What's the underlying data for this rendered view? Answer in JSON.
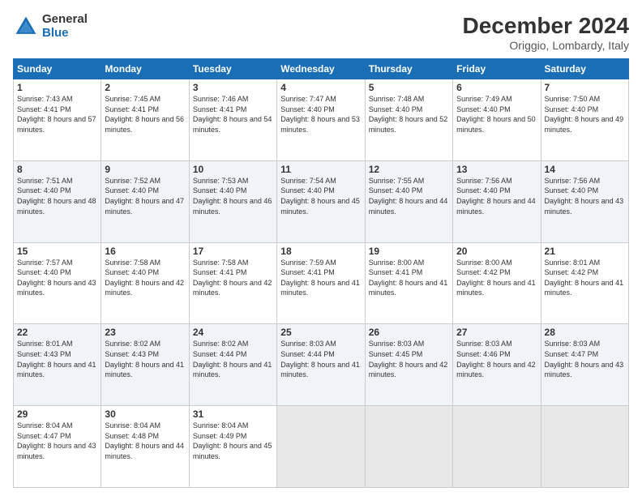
{
  "logo": {
    "general": "General",
    "blue": "Blue"
  },
  "title": {
    "month": "December 2024",
    "location": "Origgio, Lombardy, Italy"
  },
  "header": {
    "days": [
      "Sunday",
      "Monday",
      "Tuesday",
      "Wednesday",
      "Thursday",
      "Friday",
      "Saturday"
    ]
  },
  "weeks": [
    [
      {
        "day": "1",
        "sunrise": "7:43 AM",
        "sunset": "4:41 PM",
        "daylight": "8 hours and 57 minutes."
      },
      {
        "day": "2",
        "sunrise": "7:45 AM",
        "sunset": "4:41 PM",
        "daylight": "8 hours and 56 minutes."
      },
      {
        "day": "3",
        "sunrise": "7:46 AM",
        "sunset": "4:41 PM",
        "daylight": "8 hours and 54 minutes."
      },
      {
        "day": "4",
        "sunrise": "7:47 AM",
        "sunset": "4:40 PM",
        "daylight": "8 hours and 53 minutes."
      },
      {
        "day": "5",
        "sunrise": "7:48 AM",
        "sunset": "4:40 PM",
        "daylight": "8 hours and 52 minutes."
      },
      {
        "day": "6",
        "sunrise": "7:49 AM",
        "sunset": "4:40 PM",
        "daylight": "8 hours and 50 minutes."
      },
      {
        "day": "7",
        "sunrise": "7:50 AM",
        "sunset": "4:40 PM",
        "daylight": "8 hours and 49 minutes."
      }
    ],
    [
      {
        "day": "8",
        "sunrise": "7:51 AM",
        "sunset": "4:40 PM",
        "daylight": "8 hours and 48 minutes."
      },
      {
        "day": "9",
        "sunrise": "7:52 AM",
        "sunset": "4:40 PM",
        "daylight": "8 hours and 47 minutes."
      },
      {
        "day": "10",
        "sunrise": "7:53 AM",
        "sunset": "4:40 PM",
        "daylight": "8 hours and 46 minutes."
      },
      {
        "day": "11",
        "sunrise": "7:54 AM",
        "sunset": "4:40 PM",
        "daylight": "8 hours and 45 minutes."
      },
      {
        "day": "12",
        "sunrise": "7:55 AM",
        "sunset": "4:40 PM",
        "daylight": "8 hours and 44 minutes."
      },
      {
        "day": "13",
        "sunrise": "7:56 AM",
        "sunset": "4:40 PM",
        "daylight": "8 hours and 44 minutes."
      },
      {
        "day": "14",
        "sunrise": "7:56 AM",
        "sunset": "4:40 PM",
        "daylight": "8 hours and 43 minutes."
      }
    ],
    [
      {
        "day": "15",
        "sunrise": "7:57 AM",
        "sunset": "4:40 PM",
        "daylight": "8 hours and 43 minutes."
      },
      {
        "day": "16",
        "sunrise": "7:58 AM",
        "sunset": "4:40 PM",
        "daylight": "8 hours and 42 minutes."
      },
      {
        "day": "17",
        "sunrise": "7:58 AM",
        "sunset": "4:41 PM",
        "daylight": "8 hours and 42 minutes."
      },
      {
        "day": "18",
        "sunrise": "7:59 AM",
        "sunset": "4:41 PM",
        "daylight": "8 hours and 41 minutes."
      },
      {
        "day": "19",
        "sunrise": "8:00 AM",
        "sunset": "4:41 PM",
        "daylight": "8 hours and 41 minutes."
      },
      {
        "day": "20",
        "sunrise": "8:00 AM",
        "sunset": "4:42 PM",
        "daylight": "8 hours and 41 minutes."
      },
      {
        "day": "21",
        "sunrise": "8:01 AM",
        "sunset": "4:42 PM",
        "daylight": "8 hours and 41 minutes."
      }
    ],
    [
      {
        "day": "22",
        "sunrise": "8:01 AM",
        "sunset": "4:43 PM",
        "daylight": "8 hours and 41 minutes."
      },
      {
        "day": "23",
        "sunrise": "8:02 AM",
        "sunset": "4:43 PM",
        "daylight": "8 hours and 41 minutes."
      },
      {
        "day": "24",
        "sunrise": "8:02 AM",
        "sunset": "4:44 PM",
        "daylight": "8 hours and 41 minutes."
      },
      {
        "day": "25",
        "sunrise": "8:03 AM",
        "sunset": "4:44 PM",
        "daylight": "8 hours and 41 minutes."
      },
      {
        "day": "26",
        "sunrise": "8:03 AM",
        "sunset": "4:45 PM",
        "daylight": "8 hours and 42 minutes."
      },
      {
        "day": "27",
        "sunrise": "8:03 AM",
        "sunset": "4:46 PM",
        "daylight": "8 hours and 42 minutes."
      },
      {
        "day": "28",
        "sunrise": "8:03 AM",
        "sunset": "4:47 PM",
        "daylight": "8 hours and 43 minutes."
      }
    ],
    [
      {
        "day": "29",
        "sunrise": "8:04 AM",
        "sunset": "4:47 PM",
        "daylight": "8 hours and 43 minutes."
      },
      {
        "day": "30",
        "sunrise": "8:04 AM",
        "sunset": "4:48 PM",
        "daylight": "8 hours and 44 minutes."
      },
      {
        "day": "31",
        "sunrise": "8:04 AM",
        "sunset": "4:49 PM",
        "daylight": "8 hours and 45 minutes."
      },
      null,
      null,
      null,
      null
    ]
  ],
  "labels": {
    "sunrise": "Sunrise:",
    "sunset": "Sunset:",
    "daylight": "Daylight:"
  }
}
